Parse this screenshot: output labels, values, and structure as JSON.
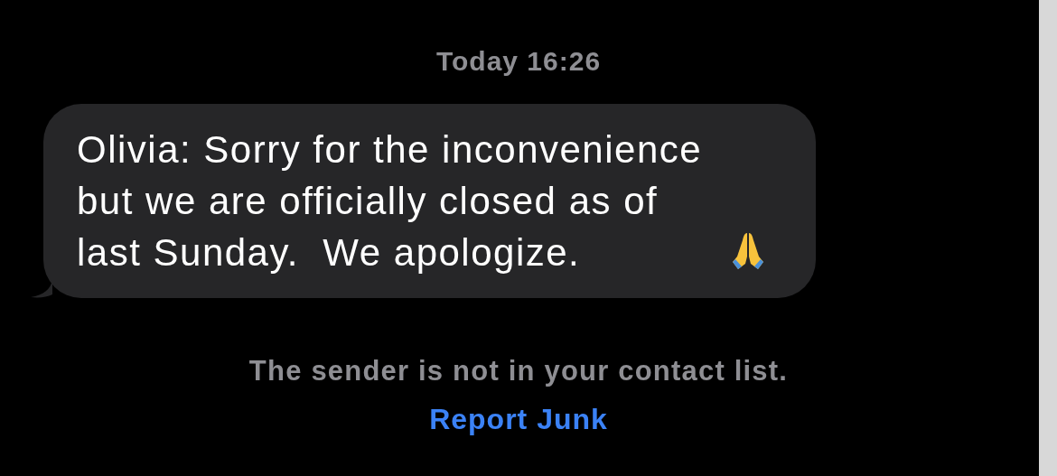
{
  "timestamp": "Today 16:26",
  "message": {
    "text": "Olivia: Sorry for the inconvenience\nbut we are officially closed as of\nlast Sunday.  We apologize."
  },
  "notice": "The sender is not in your contact list.",
  "report_link": "Report Junk"
}
